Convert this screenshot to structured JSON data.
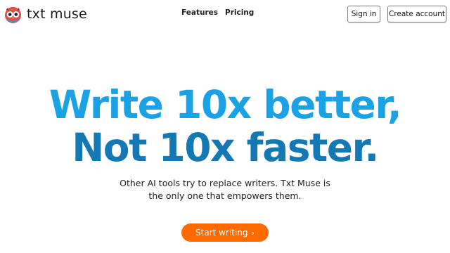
{
  "brand": {
    "name": "txt muse",
    "logo_icon": "owl-icon"
  },
  "nav": {
    "items": [
      {
        "label": "Features"
      },
      {
        "label": "Pricing"
      }
    ]
  },
  "auth": {
    "sign_in_label": "Sign in",
    "create_account_label": "Create account"
  },
  "hero": {
    "headline_line1": "Write 10x better,",
    "headline_line2": "Not 10x faster.",
    "subtitle_line1": "Other AI tools try to replace writers. Txt Muse is",
    "subtitle_line2": "the only one that empowers them.",
    "cta_label": "Start writing",
    "cta_icon": "chevron-right-icon"
  },
  "colors": {
    "headline_light_blue": "#1ba2e6",
    "headline_dark_blue": "#1478b4",
    "cta_orange": "#ff6a00"
  }
}
